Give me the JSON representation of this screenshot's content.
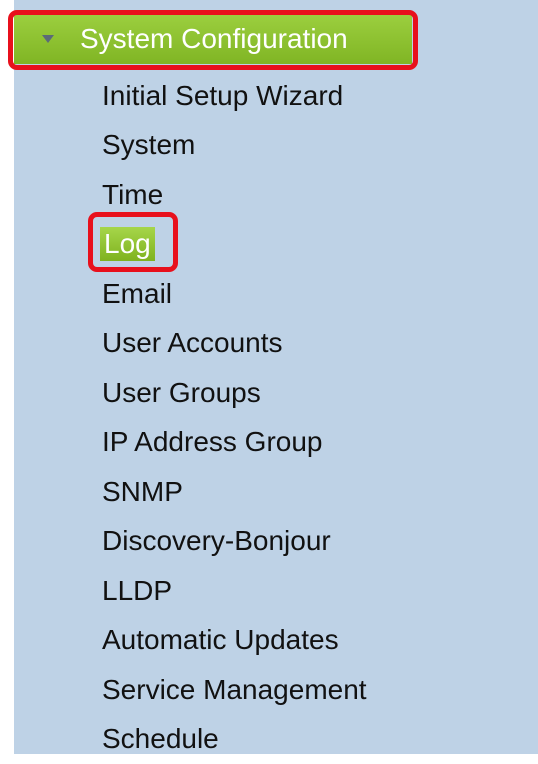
{
  "header": {
    "title": "System Configuration",
    "expanded_icon": "caret-down-icon"
  },
  "menu": {
    "items": [
      {
        "label": "Initial Setup Wizard",
        "active": false
      },
      {
        "label": "System",
        "active": false
      },
      {
        "label": "Time",
        "active": false
      },
      {
        "label": "Log",
        "active": true
      },
      {
        "label": "Email",
        "active": false
      },
      {
        "label": "User Accounts",
        "active": false
      },
      {
        "label": "User Groups",
        "active": false
      },
      {
        "label": "IP Address Group",
        "active": false
      },
      {
        "label": "SNMP",
        "active": false
      },
      {
        "label": "Discovery-Bonjour",
        "active": false
      },
      {
        "label": "LLDP",
        "active": false
      },
      {
        "label": "Automatic Updates",
        "active": false
      },
      {
        "label": "Service Management",
        "active": false
      },
      {
        "label": "Schedule",
        "active": false
      }
    ]
  },
  "colors": {
    "panel_background": "#bed2e6",
    "header_green": "#8cc234",
    "active_green": "#93c638",
    "annotation_red": "#e8101c"
  }
}
